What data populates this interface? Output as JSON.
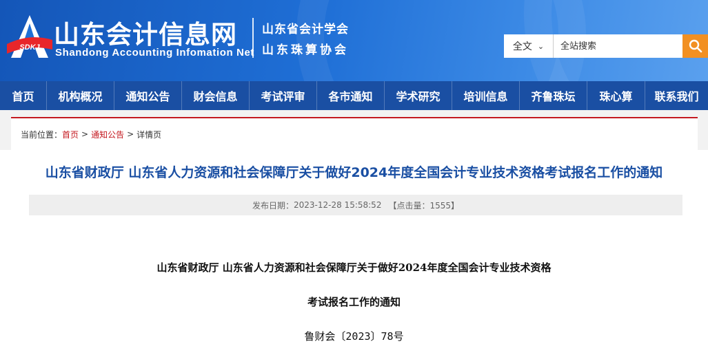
{
  "header": {
    "logo_text": "SDKJ",
    "site_title": "山东会计信息网",
    "site_subtitle": "Shandong Accounting Infomation Net",
    "org_lines": [
      "山东省会计学会",
      "山东珠算协会"
    ]
  },
  "search": {
    "scope_selected": "全文",
    "placeholder": "全站搜索",
    "button_icon": "search-icon"
  },
  "nav": {
    "items": [
      "首页",
      "机构概况",
      "通知公告",
      "财会信息",
      "考试评审",
      "各市通知",
      "学术研究",
      "培训信息",
      "齐鲁珠坛",
      "珠心算",
      "联系我们"
    ]
  },
  "breadcrumb": {
    "prefix": "当前位置：",
    "items": [
      "首页",
      "通知公告",
      "详情页"
    ],
    "separator": ">"
  },
  "article": {
    "title": "山东省财政厅 山东省人力资源和社会保障厅关于做好2024年度全国会计专业技术资格考试报名工作的通知",
    "meta": {
      "date_label": "发布日期：",
      "date": "2023-12-28 15:58:52",
      "hits_text": "【点击量：1555】"
    },
    "body_lines": [
      "山东省财政厅 山东省人力资源和社会保障厅关于做好2024年度全国会计专业技术资格",
      "考试报名工作的通知",
      "鲁财会〔2023〕78号"
    ]
  },
  "colors": {
    "header_blue": "#1f6fd6",
    "nav_blue": "#1a4fa3",
    "accent_red": "#c4181f",
    "search_orange": "#f29022"
  }
}
